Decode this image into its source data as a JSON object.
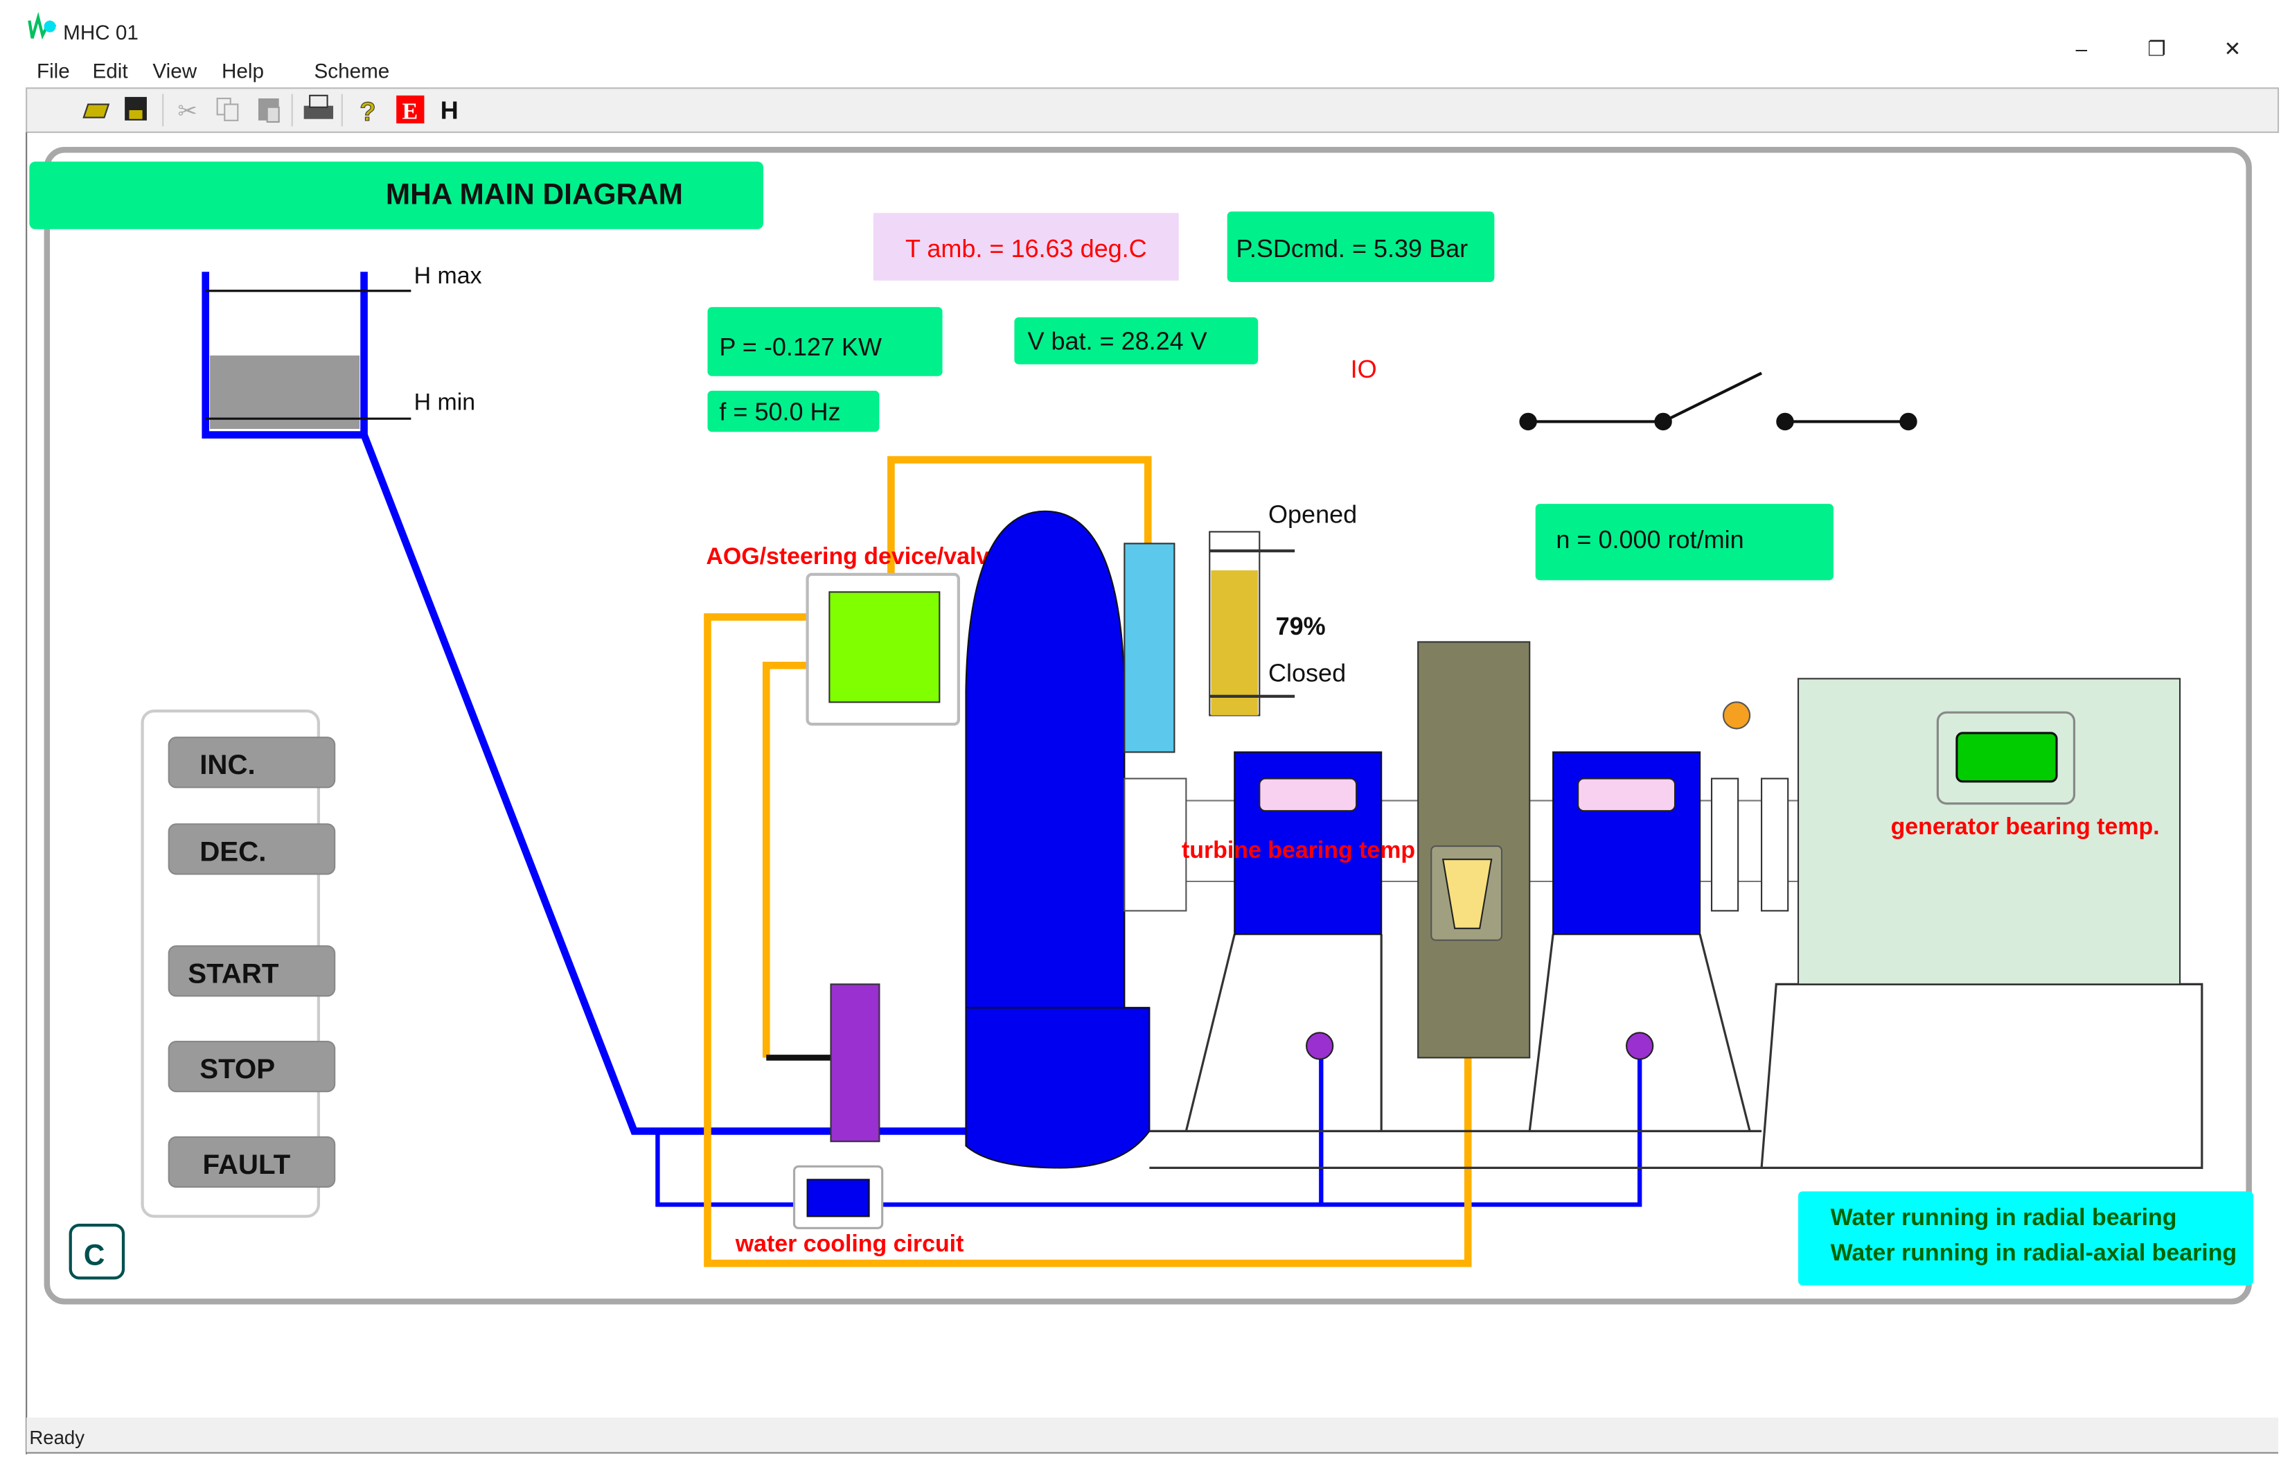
{
  "window": {
    "title": "MHC 01",
    "minimize": "–",
    "restore": "❐",
    "close": "✕"
  },
  "menu": [
    "File",
    "Edit",
    "View",
    "Help",
    "Scheme"
  ],
  "toolbar": {
    "help_label": "?",
    "e_label": "E",
    "h_label": "H",
    "icons": [
      "open-folder-icon",
      "save-icon",
      "cut-icon",
      "copy-icon",
      "paste-icon",
      "print-icon",
      "help-icon",
      "e-icon",
      "h-icon"
    ]
  },
  "diagram": {
    "title": "MHA MAIN DIAGRAM",
    "t_amb": "T amb. = 16.63 deg.C",
    "psd_cmd": "P.SDcmd. = 5.39 Bar",
    "power": "P = -0.127 KW",
    "freq": "f = 50.0 Hz",
    "vbat": "V bat. = 28.24 V",
    "io": "IO",
    "speed": "n = 0.000 rot/min",
    "h_max": "H max",
    "h_min": "H min",
    "aog_label": "AOG/steering device/valve",
    "valve_opened": "Opened",
    "valve_closed": "Closed",
    "valve_percent": "79%",
    "valve_fraction": 0.79,
    "turbine_bearing_label": "turbine bearing temp",
    "generator_bearing_label": "generator bearing temp.",
    "water_cooling_label": "water cooling circuit",
    "status_lines": [
      "Water running in radial bearing",
      "Water running in radial-axial bearing"
    ]
  },
  "controls": {
    "inc": "INC.",
    "dec": "DEC.",
    "start": "START",
    "stop": "STOP",
    "fault": "FAULT",
    "c": "C"
  },
  "statusbar": {
    "text": "Ready"
  },
  "colors": {
    "green": "#00f08c",
    "pipe_blue": "#0000ff",
    "pipe_orange": "#ffb000",
    "alert_red": "#ff0000",
    "cyan": "#00ffff"
  }
}
